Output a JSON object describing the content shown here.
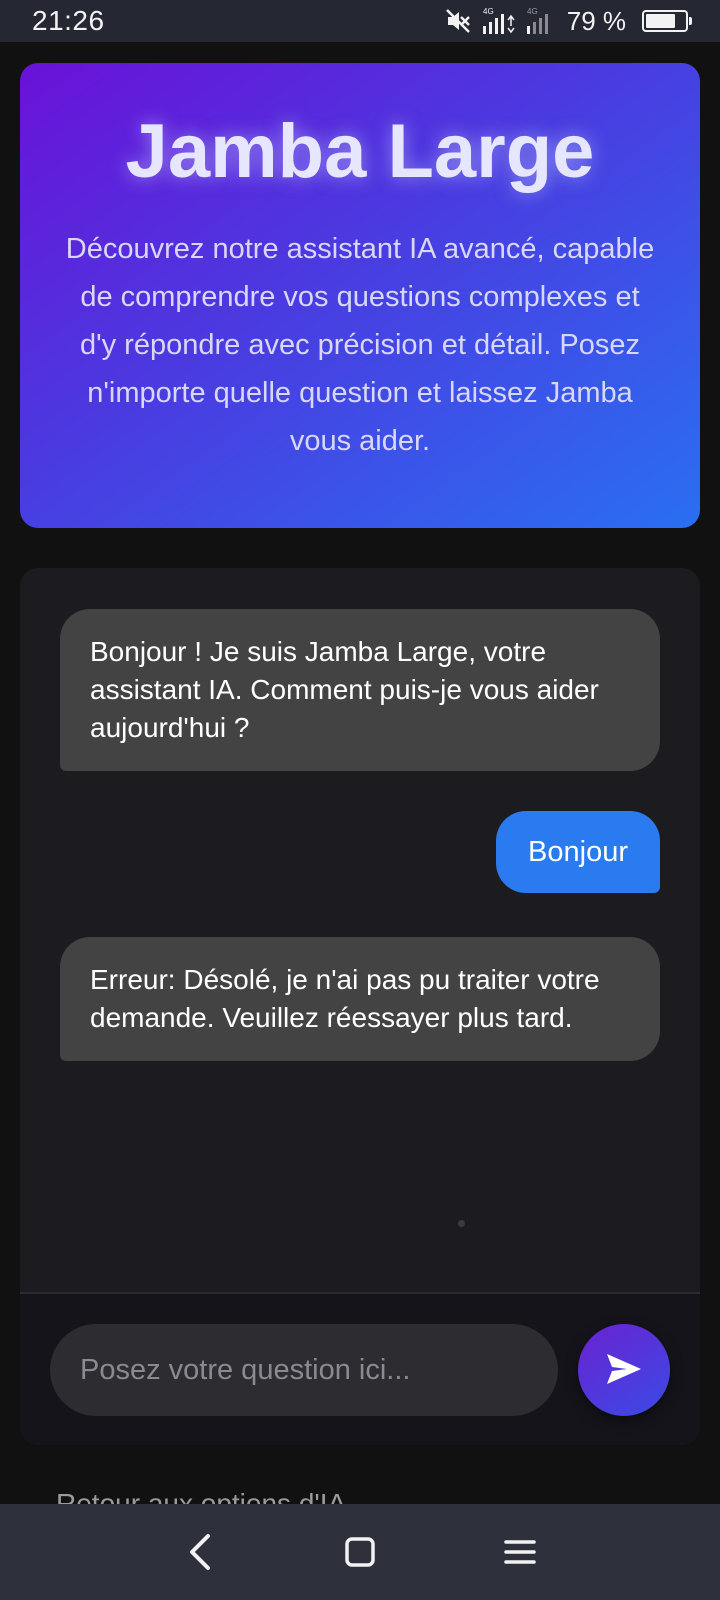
{
  "status_bar": {
    "time": "21:26",
    "battery": "79 %",
    "battery_level": 0.79,
    "icons": [
      "mute-icon",
      "signal-4g-icon",
      "signal-4g-weak-icon",
      "battery-icon"
    ]
  },
  "hero": {
    "title": "Jamba Large",
    "description": "Découvrez notre assistant IA avancé, capable de comprendre vos questions complexes et d'y répondre avec précision et détail. Posez n'importe quelle question et laissez Jamba vous aider."
  },
  "chat": {
    "messages": [
      {
        "role": "assistant",
        "text": "Bonjour ! Je suis Jamba Large, votre assistant IA. Comment puis-je vous aider aujourd'hui ?"
      },
      {
        "role": "user",
        "text": "Bonjour"
      },
      {
        "role": "assistant",
        "text": "Erreur: Désolé, je n'ai pas pu traiter votre demande. Veuillez réessayer plus tard."
      }
    ],
    "input_placeholder": "Posez votre question ici...",
    "input_value": "",
    "send_icon": "send-icon"
  },
  "footer": {
    "back_link": "Retour aux options d'IA"
  },
  "nav": {
    "icons": [
      "back-icon",
      "home-icon",
      "menu-icon"
    ]
  },
  "colors": {
    "hero_gradient_start": "#6a12d8",
    "hero_gradient_end": "#2a6ff2",
    "user_bubble": "#2a7af0",
    "assistant_bubble": "#434343"
  }
}
